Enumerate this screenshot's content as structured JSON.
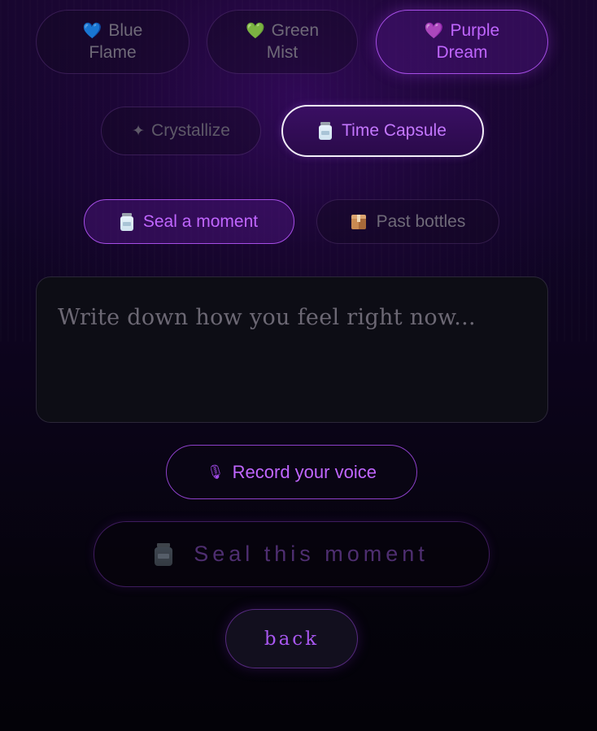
{
  "themes": [
    {
      "icon": "blue-heart-icon",
      "emoji": "💙",
      "label": "Blue Flame",
      "line1": "Blue",
      "line2": "Flame",
      "selected": false
    },
    {
      "icon": "green-heart-icon",
      "emoji": "💚",
      "label": "Green Mist",
      "line1": "Green",
      "line2": "Mist",
      "selected": false
    },
    {
      "icon": "purple-heart-icon",
      "emoji": "💜",
      "label": "Purple Dream",
      "line1": "Purple",
      "line2": "Dream",
      "selected": true
    }
  ],
  "modes": [
    {
      "icon": "sparkle-icon",
      "glyph": "✦",
      "label": "Crystallize",
      "selected": false
    },
    {
      "icon": "jar-icon",
      "label": "Time Capsule",
      "selected": true
    }
  ],
  "capsule_tabs": [
    {
      "icon": "jar-icon",
      "label": "Seal a moment",
      "selected": true
    },
    {
      "icon": "package-icon",
      "label": "Past bottles",
      "selected": false
    }
  ],
  "input": {
    "placeholder": "Write down how you feel right now...",
    "value": ""
  },
  "actions": {
    "record": {
      "icon": "microphone-icon",
      "glyph": "🎙",
      "label": "Record your voice"
    },
    "seal": {
      "icon": "jar-icon",
      "label": "Seal this moment",
      "enabled": false
    },
    "back": {
      "label": "back"
    }
  },
  "colors": {
    "accent": "#c066ff",
    "accent_border": "#a64ee6",
    "muted_text": "#6f6a78",
    "background_top": "#17062e",
    "background_bottom": "#030208"
  }
}
